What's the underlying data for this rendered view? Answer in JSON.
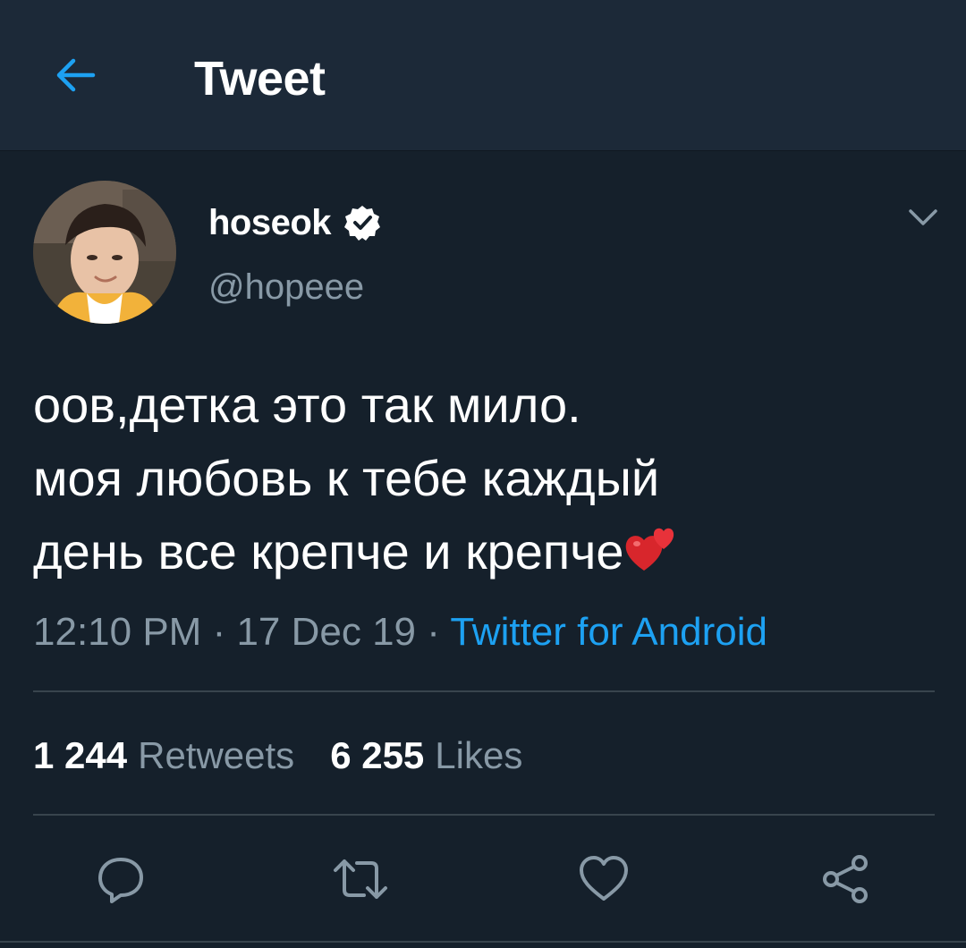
{
  "header": {
    "title": "Tweet",
    "back_icon": "arrow-left-icon"
  },
  "colors": {
    "background": "#15202b",
    "header_background": "#1c2938",
    "accent": "#1da1f2",
    "secondary_text": "#8899a6",
    "divider": "#38444d"
  },
  "tweet": {
    "author": {
      "name": "hoseok",
      "handle": "@hopeee",
      "verified": true
    },
    "text_lines": [
      "оов,детка это так мило.",
      "моя любовь к тебе каждый",
      "день все крепче и крепче"
    ],
    "emoji": "two-hearts-emoji",
    "time": "12:10 PM",
    "date": "17 Dec 19",
    "separator": " · ",
    "source": "Twitter for Android",
    "stats": {
      "retweets_count": "1 244",
      "retweets_label": "Retweets",
      "likes_count": "6 255",
      "likes_label": "Likes"
    }
  },
  "actions": [
    {
      "name": "reply",
      "icon": "reply-icon"
    },
    {
      "name": "retweet",
      "icon": "retweet-icon"
    },
    {
      "name": "like",
      "icon": "heart-icon"
    },
    {
      "name": "share",
      "icon": "share-icon"
    }
  ]
}
